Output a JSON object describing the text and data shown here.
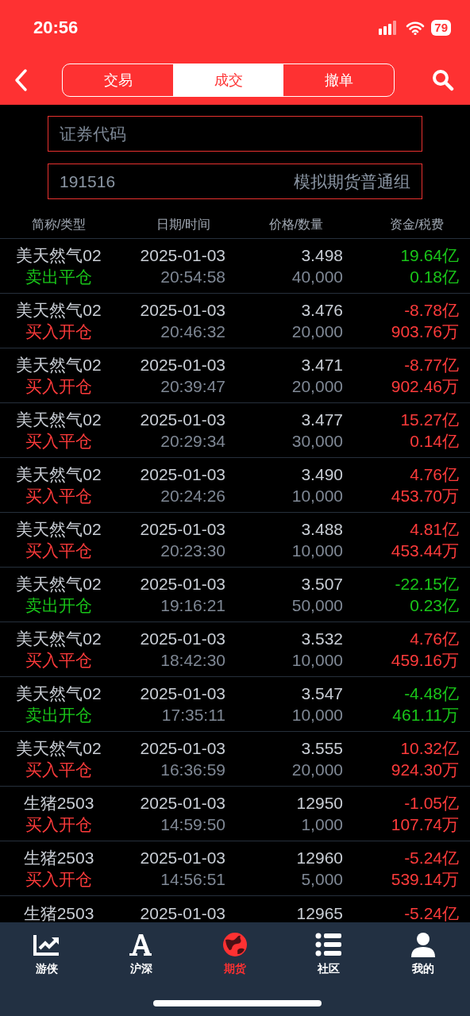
{
  "status_bar": {
    "time": "20:56",
    "battery": "79"
  },
  "header": {
    "tabs": [
      {
        "label": "交易",
        "selected": false
      },
      {
        "label": "成交",
        "selected": true
      },
      {
        "label": "撤单",
        "selected": false
      }
    ]
  },
  "filters": {
    "code_field": {
      "placeholder": "证券代码"
    },
    "account": {
      "number": "191516",
      "group": "模拟期货普通组"
    }
  },
  "table": {
    "columns": [
      "简称/类型",
      "日期/时间",
      "价格/数量",
      "资金/税费"
    ],
    "rows": [
      {
        "name": "美天然气02",
        "type": "卖出平仓",
        "kind": "sell",
        "date": "2025-01-03",
        "time": "20:54:58",
        "price": "3.498",
        "quantity": "40,000",
        "amount": "19.64亿",
        "fee": "0.18亿"
      },
      {
        "name": "美天然气02",
        "type": "买入开仓",
        "kind": "buy",
        "date": "2025-01-03",
        "time": "20:46:32",
        "price": "3.476",
        "quantity": "20,000",
        "amount": "-8.78亿",
        "fee": "903.76万"
      },
      {
        "name": "美天然气02",
        "type": "买入开仓",
        "kind": "buy",
        "date": "2025-01-03",
        "time": "20:39:47",
        "price": "3.471",
        "quantity": "20,000",
        "amount": "-8.77亿",
        "fee": "902.46万"
      },
      {
        "name": "美天然气02",
        "type": "买入平仓",
        "kind": "buy",
        "date": "2025-01-03",
        "time": "20:29:34",
        "price": "3.477",
        "quantity": "30,000",
        "amount": "15.27亿",
        "fee": "0.14亿"
      },
      {
        "name": "美天然气02",
        "type": "买入平仓",
        "kind": "buy",
        "date": "2025-01-03",
        "time": "20:24:26",
        "price": "3.490",
        "quantity": "10,000",
        "amount": "4.76亿",
        "fee": "453.70万"
      },
      {
        "name": "美天然气02",
        "type": "买入平仓",
        "kind": "buy",
        "date": "2025-01-03",
        "time": "20:23:30",
        "price": "3.488",
        "quantity": "10,000",
        "amount": "4.81亿",
        "fee": "453.44万"
      },
      {
        "name": "美天然气02",
        "type": "卖出开仓",
        "kind": "sell",
        "date": "2025-01-03",
        "time": "19:16:21",
        "price": "3.507",
        "quantity": "50,000",
        "amount": "-22.15亿",
        "fee": "0.23亿"
      },
      {
        "name": "美天然气02",
        "type": "买入平仓",
        "kind": "buy",
        "date": "2025-01-03",
        "time": "18:42:30",
        "price": "3.532",
        "quantity": "10,000",
        "amount": "4.76亿",
        "fee": "459.16万"
      },
      {
        "name": "美天然气02",
        "type": "卖出开仓",
        "kind": "sell",
        "date": "2025-01-03",
        "time": "17:35:11",
        "price": "3.547",
        "quantity": "10,000",
        "amount": "-4.48亿",
        "fee": "461.11万"
      },
      {
        "name": "美天然气02",
        "type": "买入平仓",
        "kind": "buy",
        "date": "2025-01-03",
        "time": "16:36:59",
        "price": "3.555",
        "quantity": "20,000",
        "amount": "10.32亿",
        "fee": "924.30万"
      },
      {
        "name": "生猪2503",
        "type": "买入开仓",
        "kind": "buy",
        "date": "2025-01-03",
        "time": "14:59:50",
        "price": "12950",
        "quantity": "1,000",
        "amount": "-1.05亿",
        "fee": "107.74万"
      },
      {
        "name": "生猪2503",
        "type": "买入开仓",
        "kind": "buy",
        "date": "2025-01-03",
        "time": "14:56:51",
        "price": "12960",
        "quantity": "5,000",
        "amount": "-5.24亿",
        "fee": "539.14万"
      },
      {
        "name": "生猪2503",
        "kind": "buy",
        "date": "2025-01-03",
        "price": "12965",
        "amount": "-5.24亿"
      }
    ]
  },
  "tab_bar": {
    "items": [
      {
        "label": "游侠",
        "selected": false
      },
      {
        "label": "沪深",
        "selected": false
      },
      {
        "label": "期货",
        "selected": true
      },
      {
        "label": "社区",
        "selected": false
      },
      {
        "label": "我的",
        "selected": false
      }
    ]
  }
}
